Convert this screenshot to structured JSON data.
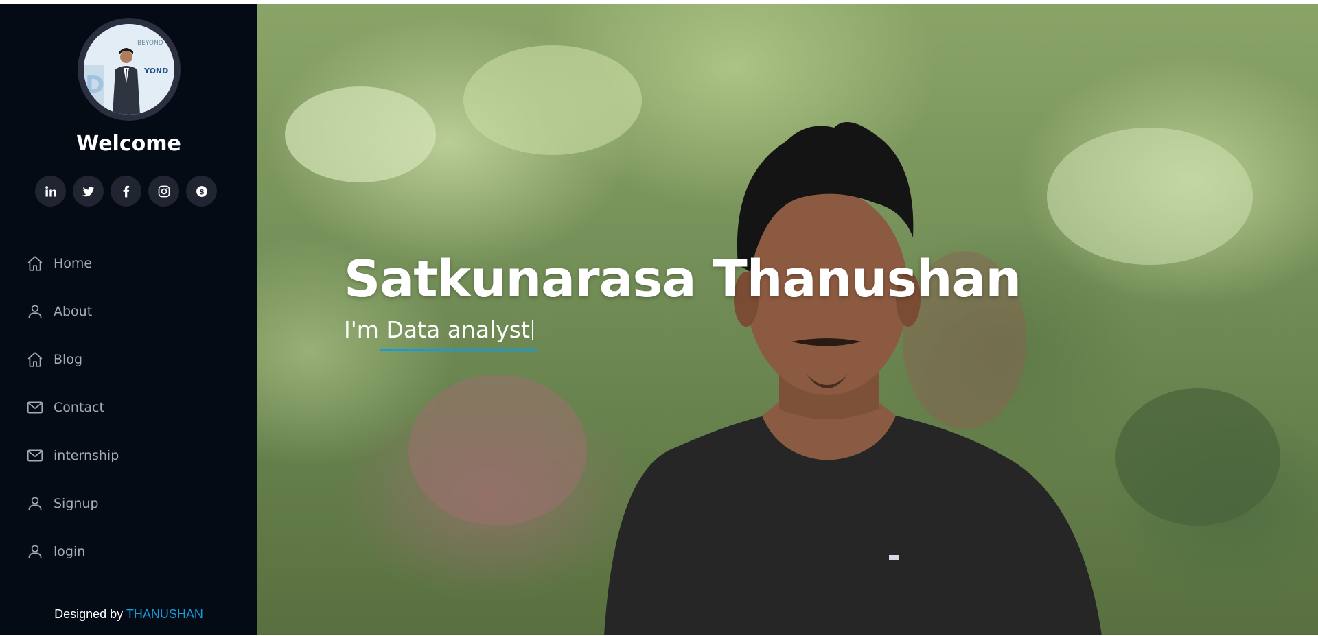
{
  "sidebar": {
    "welcome": "Welcome",
    "socials": [
      {
        "name": "linkedin-icon",
        "glyph": "in"
      },
      {
        "name": "twitter-icon"
      },
      {
        "name": "facebook-icon",
        "glyph": "f"
      },
      {
        "name": "instagram-icon"
      },
      {
        "name": "skype-icon"
      }
    ],
    "nav": [
      {
        "label": "Home",
        "icon": "home-icon"
      },
      {
        "label": "About",
        "icon": "user-icon"
      },
      {
        "label": "Blog",
        "icon": "home-icon"
      },
      {
        "label": "Contact",
        "icon": "envelope-icon"
      },
      {
        "label": "internship",
        "icon": "envelope-icon"
      },
      {
        "label": "Signup",
        "icon": "user-icon"
      },
      {
        "label": "login",
        "icon": "user-icon"
      }
    ],
    "credit_prefix": "Designed by ",
    "credit_name": "THANUSHAN"
  },
  "hero": {
    "title": "Satkunarasa Thanushan",
    "subtitle": "I'm Data analyst"
  },
  "colors": {
    "sidebar_bg": "#040b14",
    "accent": "#149ddd",
    "nav_text": "#a8a9b4"
  }
}
